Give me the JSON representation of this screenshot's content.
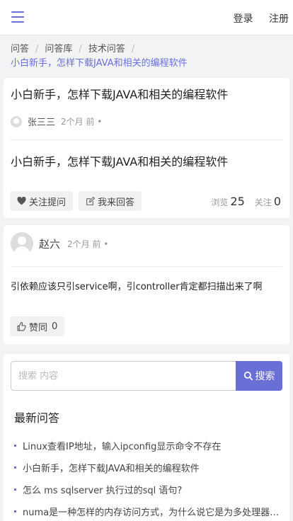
{
  "topbar": {
    "login": "登录",
    "register": "注册"
  },
  "breadcrumb": {
    "items": [
      "问答",
      "问答库",
      "技术问答"
    ],
    "separator": "/",
    "current": "小白新手，怎样下载JAVA和相关的编程软件"
  },
  "question": {
    "title": "小白新手，怎样下载JAVA和相关的编程软件",
    "author": "张三三",
    "time": "2个月 前 •",
    "body": "小白新手，怎样下载JAVA和相关的编程软件",
    "follow_label": "关注提问",
    "answer_label": "我来回答",
    "views_label": "浏览",
    "views": "25",
    "follows_label": "关注",
    "follows": "0"
  },
  "answer": {
    "author": "赵六",
    "time": "2个月 前 •",
    "text": "引依赖应该只引service啊，引controller肯定都扫描出来了啊",
    "like_label": "赞同",
    "like_count": "0"
  },
  "search": {
    "placeholder": "搜索 内容",
    "button": "搜索"
  },
  "latest": {
    "title": "最新问答",
    "items": [
      "Linux查看IP地址，输入ipconfig显示命令不存在",
      "小白新手，怎样下载JAVA和相关的编程软件",
      "怎么 ms sqlserver 执行过的sql 语句?",
      "numa是一种怎样的内存访问方式，为什么说它是为多处理器设计的"
    ]
  },
  "colors": {
    "accent": "#6a6fd8",
    "background": "#f2f3f5"
  }
}
